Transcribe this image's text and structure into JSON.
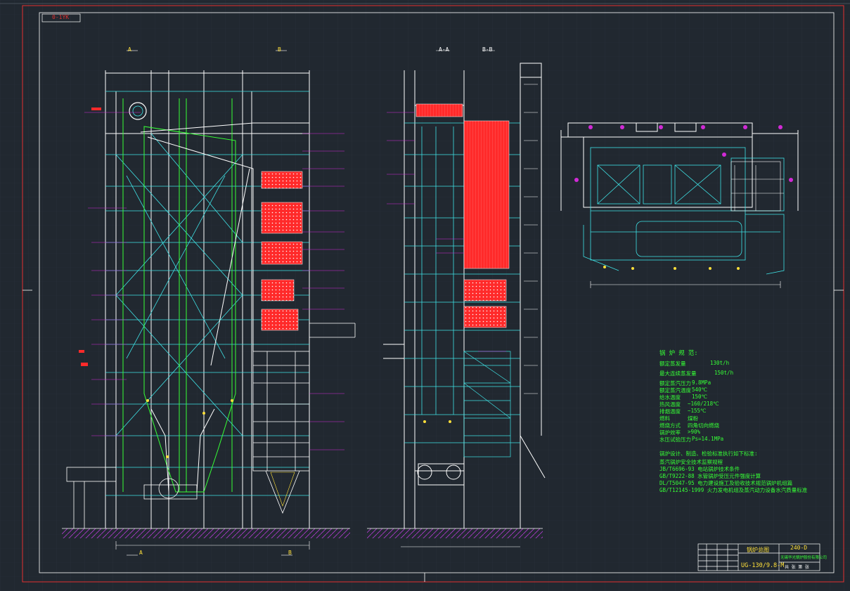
{
  "drawing": {
    "corner_tag": "0-1YK",
    "section_a_top": "A",
    "section_b_top": "B",
    "section_a_bottom": "A",
    "section_b_bottom": "B",
    "section_view_label": "A-A",
    "section_view_label2": "B-B"
  },
  "specs": {
    "title": "锅 炉 规 范:",
    "rows": [
      {
        "label": "额定蒸发量",
        "value": "130t/h"
      },
      {
        "label": "最大连续蒸发量",
        "value": "150t/h"
      },
      {
        "label": "额定蒸汽压力",
        "value": "9.8MPa"
      },
      {
        "label": "额定蒸汽温度",
        "value": "540℃"
      },
      {
        "label": "给水温度",
        "value": "150℃"
      },
      {
        "label": "热风温度",
        "value": "~160/218℃"
      },
      {
        "label": "排烟温度",
        "value": "~155℃"
      },
      {
        "label": "燃料",
        "value": "煤粉"
      },
      {
        "label": "燃烧方式",
        "value": "四角切向燃烧"
      },
      {
        "label": "锅炉效率",
        "value": ">90%"
      },
      {
        "label": "水压试验压力",
        "value": "Ps=14.1MPa"
      }
    ],
    "notes_title": "锅炉设计、制造、检验标准执行如下标准:",
    "notes": [
      "蒸汽锅炉安全技术监察规程",
      "JB/T6696-93  电站锅炉技术条件",
      "GB/T9222-88  水管锅炉受压元件强度计算",
      "DL/T5047-95  电力建设施工及验收技术规范锅炉机组篇",
      "GB/T12145-1999  火力发电机组及蒸汽动力设备水汽质量标准"
    ]
  },
  "title_block": {
    "name": "锅炉总图",
    "drawing_no": "240-D",
    "model": "UG-130/9.8-M",
    "company": "无锡华光锅炉股份有限公司",
    "sheet": "共 张 第 张"
  },
  "colors": {
    "background": "#212830",
    "cyan": "#3fe3e6",
    "white": "#ffffff",
    "green": "#36ff36",
    "magenta": "#d12ad6",
    "red": "#ff2a2a",
    "yellow": "#ffe03a",
    "frame": "#e23030"
  }
}
